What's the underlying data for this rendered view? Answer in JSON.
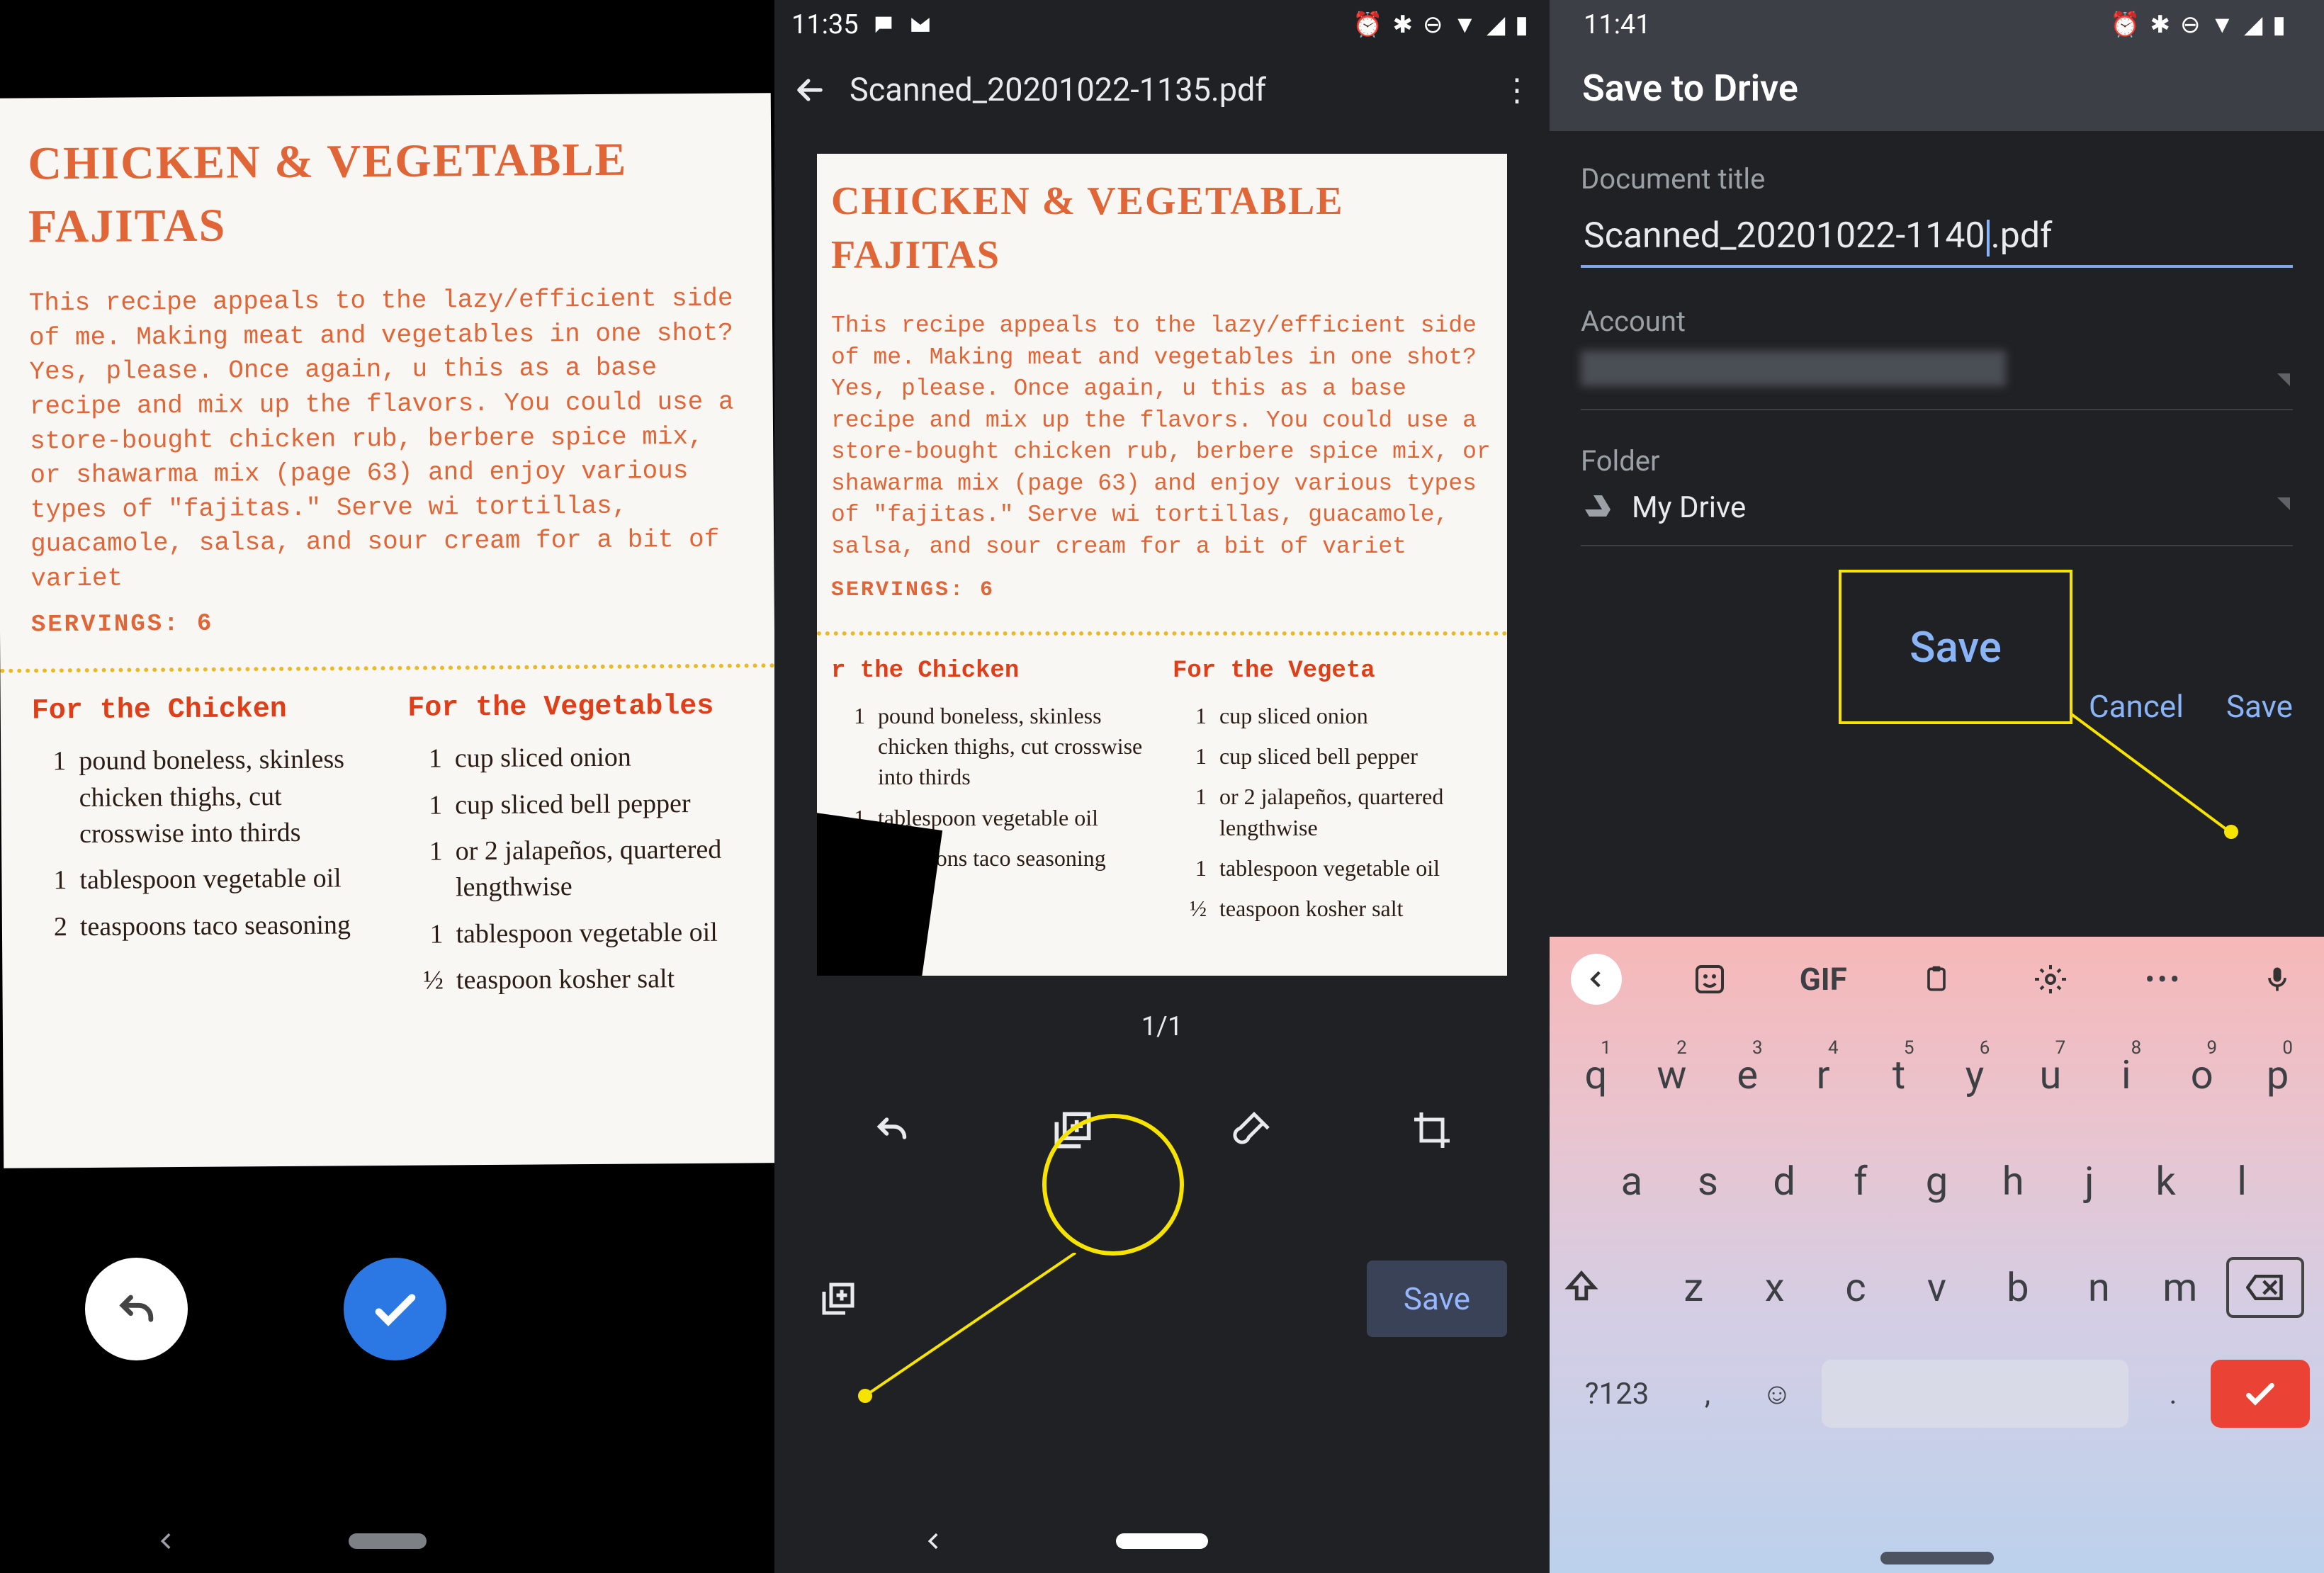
{
  "recipe": {
    "title_line1": "CHICKEN & VEGETABLE",
    "title_line2": "FAJITAS",
    "description": "This recipe appeals to the lazy/efficient side of me. Making meat and vegetables in one shot? Yes, please. Once again, u this as a base recipe and mix up the flavors. You could use a store-bought chicken rub, berbere spice mix, or shawarma mix (page 63) and enjoy various types of \"fajitas.\" Serve wi tortillas, guacamole, salsa, and sour cream for a bit of variet",
    "servings": "SERVINGS: 6",
    "col1_heading": "For the Chicken",
    "col2_heading": "For the Vegetables",
    "chicken_items": [
      {
        "amt": "1",
        "text": "pound boneless, skinless chicken thighs, cut crosswise into thirds"
      },
      {
        "amt": "1",
        "text": "tablespoon vegetable oil"
      },
      {
        "amt": "2",
        "text": "teaspoons taco seasoning"
      }
    ],
    "veg_items": [
      {
        "amt": "1",
        "text": "cup sliced onion"
      },
      {
        "amt": "1",
        "text": "cup sliced bell pepper"
      },
      {
        "amt": "1",
        "text": "or 2 jalapeños, quartered lengthwise"
      },
      {
        "amt": "1",
        "text": "tablespoon vegetable oil"
      },
      {
        "amt": "½",
        "text": "teaspoon kosher salt"
      }
    ]
  },
  "panel2": {
    "status_time": "11:35",
    "header_title": "Scanned_20201022-1135.pdf",
    "page_indicator": "1/1",
    "save_label": "Save"
  },
  "panel3": {
    "status_time": "11:41",
    "header_title": "Save to Drive",
    "doc_title_label": "Document title",
    "doc_title_before": "Scanned_20201022-1140",
    "doc_title_after": ".pdf",
    "account_label": "Account",
    "folder_label": "Folder",
    "folder_value": "My Drive",
    "save_big": "Save",
    "cancel": "Cancel",
    "save": "Save"
  },
  "keyboard": {
    "gif": "GIF",
    "row1": [
      {
        "num": "1",
        "ch": "q"
      },
      {
        "num": "2",
        "ch": "w"
      },
      {
        "num": "3",
        "ch": "e"
      },
      {
        "num": "4",
        "ch": "r"
      },
      {
        "num": "5",
        "ch": "t"
      },
      {
        "num": "6",
        "ch": "y"
      },
      {
        "num": "7",
        "ch": "u"
      },
      {
        "num": "8",
        "ch": "i"
      },
      {
        "num": "9",
        "ch": "o"
      },
      {
        "num": "0",
        "ch": "p"
      }
    ],
    "row2": [
      "a",
      "s",
      "d",
      "f",
      "g",
      "h",
      "j",
      "k",
      "l"
    ],
    "row3": [
      "z",
      "x",
      "c",
      "v",
      "b",
      "n",
      "m"
    ],
    "sym": "?123",
    "comma": ",",
    "period": "."
  }
}
